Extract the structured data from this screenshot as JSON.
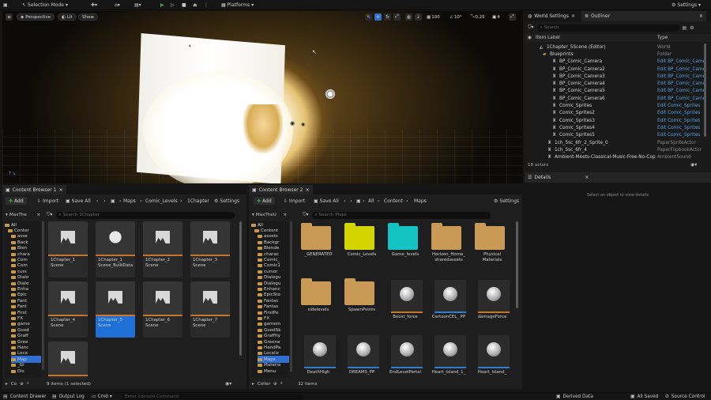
{
  "topbar": {
    "selection_mode": "Selection Mode",
    "platforms": "Platforms",
    "settings": "Settings"
  },
  "viewport": {
    "perspective": "Perspective",
    "lit": "Lit",
    "show": "Show",
    "grid_size": "100",
    "rotation": "10°",
    "scale": "0.25",
    "speed": "4"
  },
  "panels": {
    "world_settings": "World Settings",
    "outliner": "Outliner",
    "search_placeholder": "Search",
    "col_label": "Item Label",
    "col_type": "Type",
    "actors": "18 actors",
    "details": "Details",
    "details_hint": "Select an object to view details"
  },
  "outliner_rows": [
    {
      "label": "1Chapter_5Scene (Editor)",
      "type": "World",
      "link": false,
      "indent": 28
    },
    {
      "label": "Blueprints",
      "type": "Folder",
      "link": false,
      "indent": 32
    },
    {
      "label": "BP_Comic_Camera",
      "type": "Edit BP_Comic_Came",
      "link": true,
      "indent": 44
    },
    {
      "label": "BP_Comic_Camera2",
      "type": "Edit BP_Comic_Came",
      "link": true,
      "indent": 44
    },
    {
      "label": "BP_Comic_Camera3",
      "type": "Edit BP_Comic_Came",
      "link": true,
      "indent": 44
    },
    {
      "label": "BP_Comic_Camera4",
      "type": "Edit BP_Comic_Came",
      "link": true,
      "indent": 44
    },
    {
      "label": "BP_Comic_Camera5",
      "type": "Edit BP_Comic_Came",
      "link": true,
      "indent": 44
    },
    {
      "label": "BP_Comic_Camera6",
      "type": "Edit BP_Comic_Came",
      "link": true,
      "indent": 44
    },
    {
      "label": "Comic_Sprites",
      "type": "Edit Comic_Sprites",
      "link": true,
      "indent": 44
    },
    {
      "label": "Comic_Sprites2",
      "type": "Edit Comic_Sprites",
      "link": true,
      "indent": 44
    },
    {
      "label": "Comic_Sprites3",
      "type": "Edit Comic_Sprites",
      "link": true,
      "indent": 44
    },
    {
      "label": "Comic_Sprites4",
      "type": "Edit Comic_Sprites",
      "link": true,
      "indent": 44
    },
    {
      "label": "Comic_Sprites5",
      "type": "Edit Comic_Sprites",
      "link": true,
      "indent": 44
    },
    {
      "label": "1ch_5sc_6fr_2_Sprite_0",
      "type": "PaperSpriteActor",
      "link": false,
      "indent": 38
    },
    {
      "label": "1ch_5sc_6fr_4",
      "type": "PaperFlipbookActor",
      "link": false,
      "indent": 38
    },
    {
      "label": "Ambient-Meets-Classical-Music-Free-No-Cop",
      "type": "AmbientSound",
      "link": false,
      "indent": 38
    }
  ],
  "cb1": {
    "tab": "Content Browser 1",
    "add": "Add",
    "import": "Import",
    "save_all": "Save All",
    "settings": "Settings",
    "path": [
      "Maps",
      "Comic_Levels",
      "1Chapter"
    ],
    "search_placeholder": "Search 1Chapter",
    "tree_root": "MaxThe",
    "status": "9 items (1 selected)",
    "collections": "Co",
    "tree": [
      "All",
      "Conter",
      "asse",
      "Back",
      "Blen",
      "chara",
      "Com",
      "Com",
      "curs",
      "Dialo",
      "Dialo",
      "Enha",
      "Epic",
      "Fant",
      "Fant",
      "First",
      "FX",
      "game",
      "Good",
      "Graff",
      "Gree",
      "Hanc",
      "Loca",
      "Map",
      "_Gl",
      "Dis"
    ],
    "tiles": [
      "1Chapter_1 Scene",
      "1Chapter_1 Scene_BuiltData",
      "1Chapter_2 Scene",
      "1Chapter_3 Scene",
      "1Chapter_4 Scene",
      "1Chapter_5 Scene",
      "1Chapter_6 Scene",
      "1Chapter_7 Scene",
      ""
    ]
  },
  "cb2": {
    "tab": "Content Browser 2",
    "add": "Add",
    "import": "Import",
    "save_all": "Save All",
    "settings": "Settings",
    "path": [
      "All",
      "Content",
      "Maps"
    ],
    "search_placeholder": "Search Maps",
    "tree_root": "MaxTheU",
    "status": "32 items",
    "collections": "Coller",
    "tree": [
      "All",
      "Content",
      "assets",
      "Backgr",
      "Blende",
      "charac",
      "Comic_",
      "Comic1",
      "cursor",
      "Dialogu",
      "Dialogu",
      "Enhanc",
      "EpicSto",
      "Fantas",
      "Fantas",
      "FirstPe",
      "FX",
      "gamem",
      "GoodSk",
      "Graffity",
      "Greene",
      "HandPa",
      "Localiz",
      "Maps",
      "Materia",
      "Menu"
    ],
    "assets": [
      {
        "label": "_GENERATED",
        "kind": "folder",
        "color": "#c89a55"
      },
      {
        "label": "Comic_Levels",
        "kind": "folder",
        "color": "#d4d400"
      },
      {
        "label": "Game_levels",
        "kind": "folder",
        "color": "#14c3c3"
      },
      {
        "label": "Horizon_Home_ sharedassets",
        "kind": "folder",
        "color": "#c89a55"
      },
      {
        "label": "Physical Materials",
        "kind": "folder",
        "color": "#c89a55"
      },
      {
        "label": "sidelevels",
        "kind": "folder",
        "color": "#c89a55"
      },
      {
        "label": "SpawnPoints",
        "kind": "folder",
        "color": "#c89a55"
      },
      {
        "label": "Boost_force",
        "kind": "sphere",
        "color": "#c7742b"
      },
      {
        "label": "CartoonCEL_ PP",
        "kind": "sphere",
        "color": "#2f7fd0"
      },
      {
        "label": "damageForce",
        "kind": "sphere",
        "color": "#c7742b"
      },
      {
        "label": "DeathHigh",
        "kind": "sphere",
        "color": "#2f7fd0"
      },
      {
        "label": "DREAMS_PP",
        "kind": "sphere",
        "color": "#2f7fd0"
      },
      {
        "label": "EndLevelPortal",
        "kind": "sphere",
        "color": "#2f7fd0"
      },
      {
        "label": "Heart_Island_1_",
        "kind": "sphere",
        "color": "#2f7fd0"
      },
      {
        "label": "Heart_Island_",
        "kind": "sphere",
        "color": "#2f7fd0"
      }
    ]
  },
  "bottom": {
    "content_drawer": "Content Drawer",
    "output_log": "Output Log",
    "cmd": "Cmd",
    "console_placeholder": "Enter Console Command",
    "derived_data": "Derived Data",
    "all_saved": "All Saved",
    "source_control": "Source Control"
  }
}
